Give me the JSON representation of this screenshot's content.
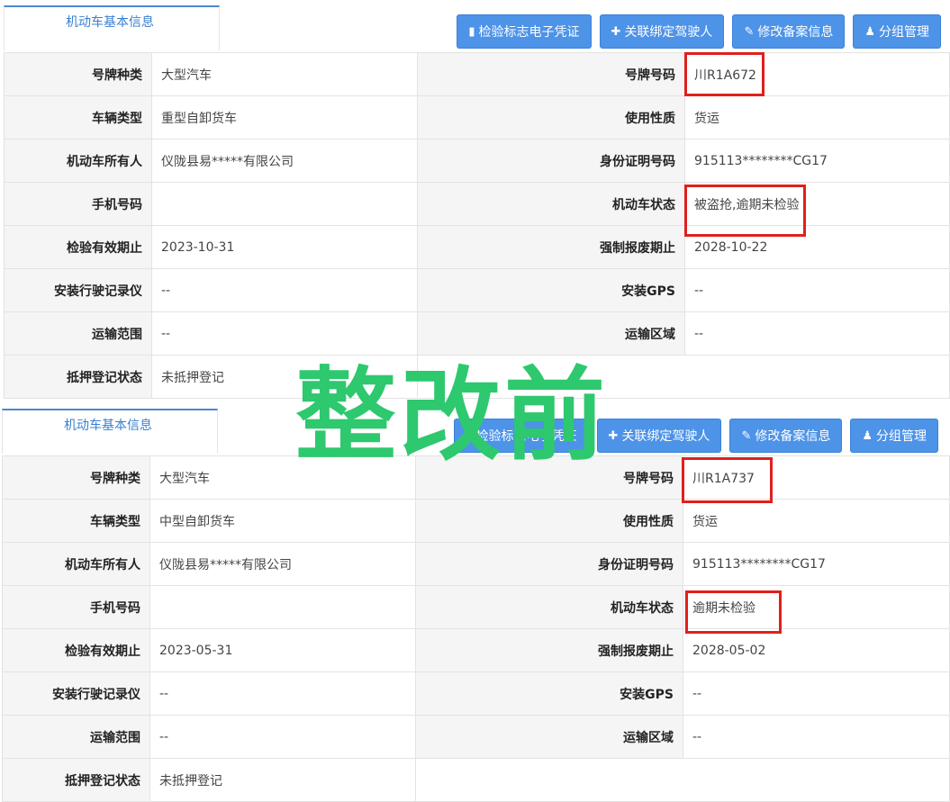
{
  "overlay_text": "整改前",
  "panels": [
    {
      "tab_title": "机动车基本信息",
      "buttons": {
        "certificate": "检验标志电子凭证",
        "bind_driver": "关联绑定驾驶人",
        "edit_record": "修改备案信息",
        "group_manage": "分组管理"
      },
      "rows": [
        {
          "l1": "号牌种类",
          "v1": "大型汽车",
          "l2": "号牌号码",
          "v2": "川R1A672"
        },
        {
          "l1": "车辆类型",
          "v1": "重型自卸货车",
          "l2": "使用性质",
          "v2": "货运"
        },
        {
          "l1": "机动车所有人",
          "v1": "仪陇县易*****有限公司",
          "l2": "身份证明号码",
          "v2": "915113********CG17"
        },
        {
          "l1": "手机号码",
          "v1": "",
          "l2": "机动车状态",
          "v2": "被盗抢,逾期未检验"
        },
        {
          "l1": "检验有效期止",
          "v1": "2023-10-31",
          "l2": "强制报废期止",
          "v2": "2028-10-22"
        },
        {
          "l1": "安装行驶记录仪",
          "v1": "--",
          "l2": "安装GPS",
          "v2": "--"
        },
        {
          "l1": "运输范围",
          "v1": "--",
          "l2": "运输区域",
          "v2": "--"
        },
        {
          "l1": "抵押登记状态",
          "v1": "未抵押登记"
        }
      ]
    },
    {
      "tab_title": "机动车基本信息",
      "buttons": {
        "certificate": "检验标志电子凭证",
        "bind_driver": "关联绑定驾驶人",
        "edit_record": "修改备案信息",
        "group_manage": "分组管理"
      },
      "rows": [
        {
          "l1": "号牌种类",
          "v1": "大型汽车",
          "l2": "号牌号码",
          "v2": "川R1A737"
        },
        {
          "l1": "车辆类型",
          "v1": "中型自卸货车",
          "l2": "使用性质",
          "v2": "货运"
        },
        {
          "l1": "机动车所有人",
          "v1": "仪陇县易*****有限公司",
          "l2": "身份证明号码",
          "v2": "915113********CG17"
        },
        {
          "l1": "手机号码",
          "v1": "",
          "l2": "机动车状态",
          "v2": "逾期未检验"
        },
        {
          "l1": "检验有效期止",
          "v1": "2023-05-31",
          "l2": "强制报废期止",
          "v2": "2028-05-02"
        },
        {
          "l1": "安装行驶记录仪",
          "v1": "--",
          "l2": "安装GPS",
          "v2": "--"
        },
        {
          "l1": "运输范围",
          "v1": "--",
          "l2": "运输区域",
          "v2": "--"
        },
        {
          "l1": "抵押登记状态",
          "v1": "未抵押登记"
        }
      ]
    }
  ],
  "icons": {
    "certificate": "file-icon",
    "bind_driver": "plus-icon",
    "edit_record": "pencil-icon",
    "group_manage": "group-icon"
  },
  "colors": {
    "button_bg": "#4d93e8",
    "tab_title": "#3a7fd1",
    "highlight_box": "#e0201c",
    "overlay_text": "#2ec86e"
  }
}
